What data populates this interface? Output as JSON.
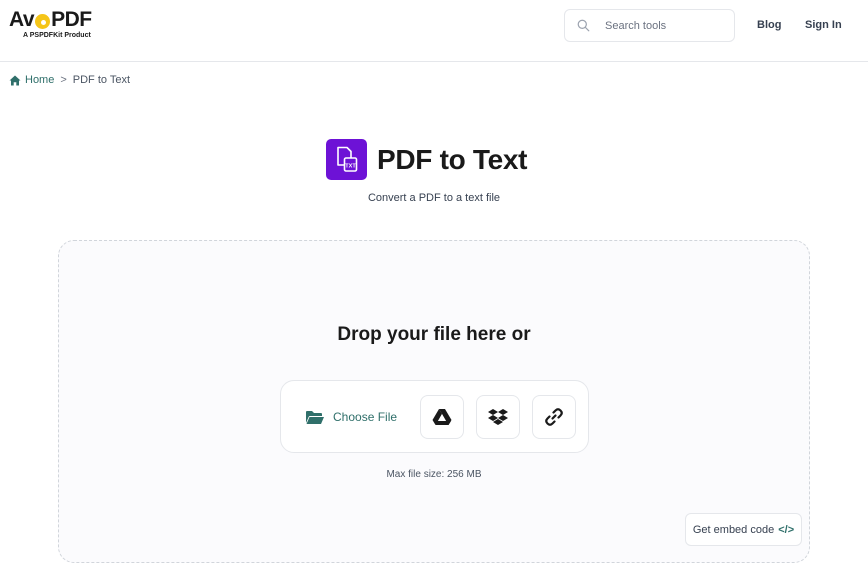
{
  "header": {
    "logo_text_left": "Av",
    "logo_text_right": "PDF",
    "logo_sub": "A PSPDFKit Product",
    "search_placeholder": "Search tools",
    "nav": {
      "blog": "Blog",
      "signin": "Sign In"
    }
  },
  "breadcrumb": {
    "home": "Home",
    "separator": ">",
    "current": "PDF to Text"
  },
  "tool": {
    "title": "PDF to Text",
    "subtitle": "Convert a PDF to a text file",
    "icon_color": "#6d12d6"
  },
  "dropzone": {
    "heading": "Drop your file here or",
    "choose_file": "Choose File",
    "max_size": "Max file size: 256 MB",
    "embed_label": "Get embed code",
    "embed_icon_text": "</>"
  },
  "colors": {
    "accent": "#2f6f6a",
    "brand_purple": "#6d12d6",
    "logo_yellow": "#f5c518"
  }
}
